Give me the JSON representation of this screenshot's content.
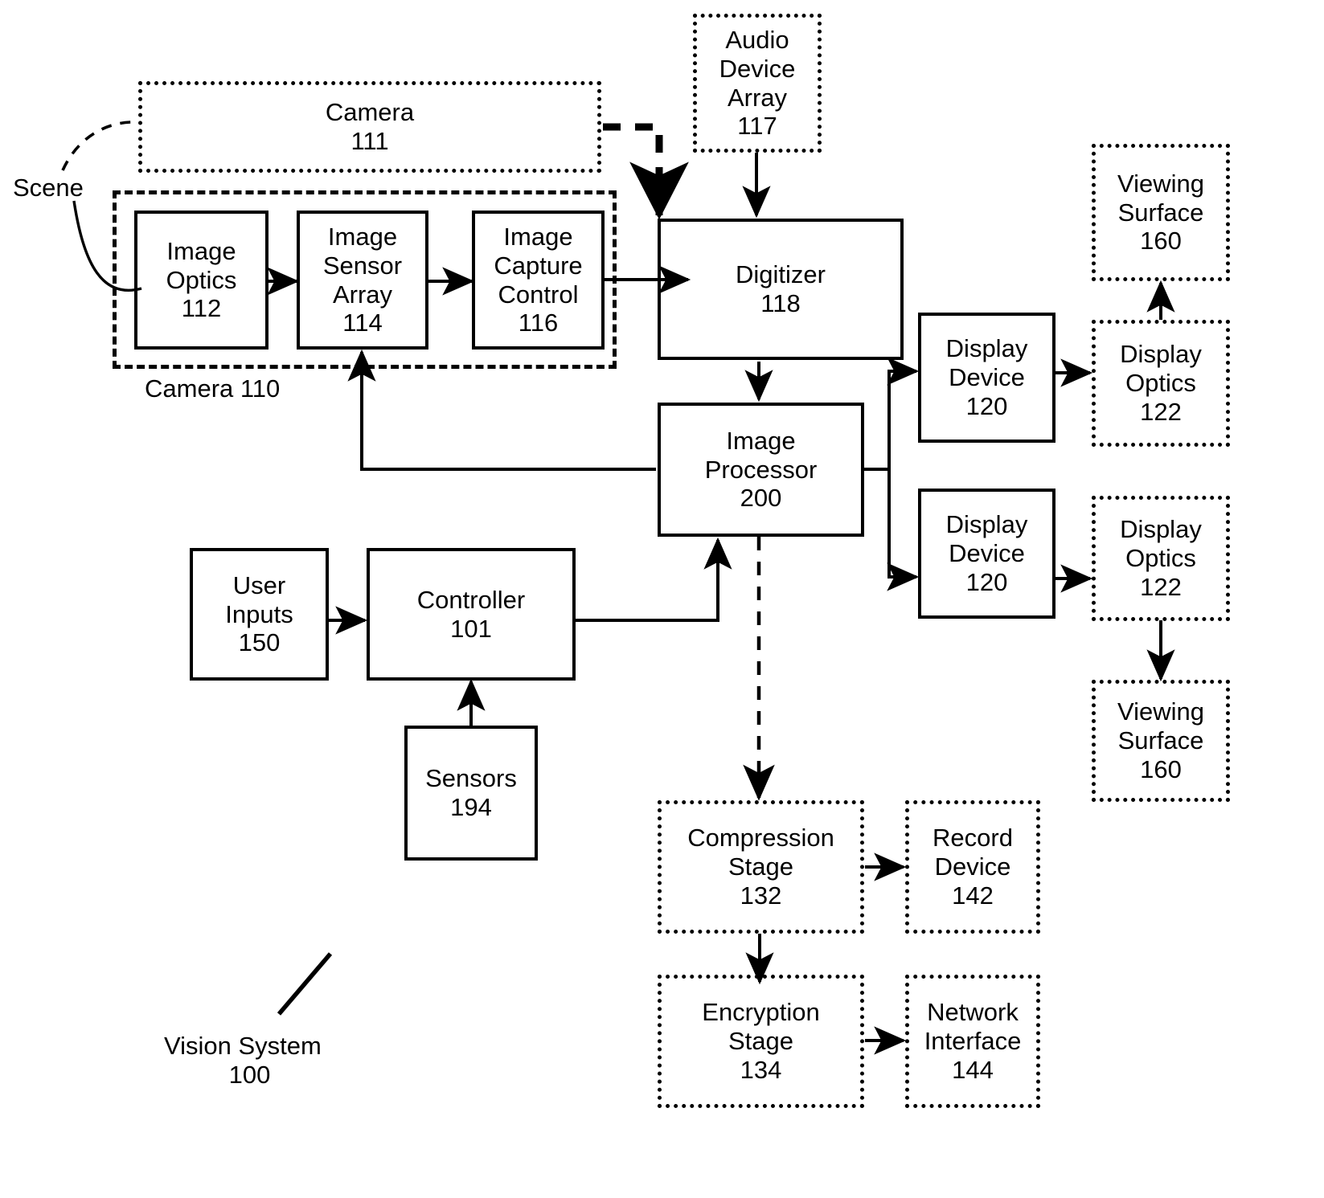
{
  "figure": {
    "title": "Vision System 100 block diagram",
    "line_color": "#000000",
    "background": "#ffffff"
  },
  "labels": {
    "scene": "Scene",
    "camera_group": "Camera 110",
    "vision_system_line1": "Vision System",
    "vision_system_line2": "100"
  },
  "nodes": {
    "camera111": {
      "line1": "Camera",
      "line2": "111",
      "style": "dotted"
    },
    "audio_device_array": {
      "line1": "Audio",
      "line2": "Device",
      "line3": "Array",
      "line4": "117",
      "style": "dotted"
    },
    "image_optics": {
      "line1": "Image",
      "line2": "Optics",
      "line3": "112",
      "style": "solid"
    },
    "image_sensor_array": {
      "line1": "Image",
      "line2": "Sensor",
      "line3": "Array",
      "line4": "114",
      "style": "solid"
    },
    "image_capture_control": {
      "line1": "Image",
      "line2": "Capture",
      "line3": "Control",
      "line4": "116",
      "style": "solid"
    },
    "digitizer": {
      "line1": "Digitizer",
      "line2": "118",
      "style": "solid"
    },
    "image_processor": {
      "line1": "Image",
      "line2": "Processor",
      "line3": "200",
      "style": "solid"
    },
    "user_inputs": {
      "line1": "User",
      "line2": "Inputs",
      "line3": "150",
      "style": "solid"
    },
    "controller": {
      "line1": "Controller",
      "line2": "101",
      "style": "solid"
    },
    "sensors": {
      "line1": "Sensors",
      "line2": "194",
      "style": "solid"
    },
    "display_device_top": {
      "line1": "Display",
      "line2": "Device",
      "line3": "120",
      "style": "solid"
    },
    "display_device_bottom": {
      "line1": "Display",
      "line2": "Device",
      "line3": "120",
      "style": "solid"
    },
    "display_optics_top": {
      "line1": "Display",
      "line2": "Optics",
      "line3": "122",
      "style": "dotted"
    },
    "display_optics_bottom": {
      "line1": "Display",
      "line2": "Optics",
      "line3": "122",
      "style": "dotted"
    },
    "viewing_surface_top": {
      "line1": "Viewing",
      "line2": "Surface",
      "line3": "160",
      "style": "dotted"
    },
    "viewing_surface_bottom": {
      "line1": "Viewing",
      "line2": "Surface",
      "line3": "160",
      "style": "dotted"
    },
    "compression_stage": {
      "line1": "Compression",
      "line2": "Stage",
      "line3": "132",
      "style": "dotted"
    },
    "record_device": {
      "line1": "Record",
      "line2": "Device",
      "line3": "142",
      "style": "dotted"
    },
    "encryption_stage": {
      "line1": "Encryption",
      "line2": "Stage",
      "line3": "134",
      "style": "dotted"
    },
    "network_interface": {
      "line1": "Network",
      "line2": "Interface",
      "line3": "144",
      "style": "dotted"
    }
  },
  "connections": [
    {
      "from": "scene",
      "to": "image_optics",
      "style": "curve-solid"
    },
    {
      "from": "scene",
      "to": "camera111",
      "style": "curve-dashed"
    },
    {
      "from": "image_optics",
      "to": "image_sensor_array",
      "style": "arrow-solid"
    },
    {
      "from": "image_sensor_array",
      "to": "image_capture_control",
      "style": "arrow-solid"
    },
    {
      "from": "image_capture_control",
      "to": "digitizer",
      "style": "arrow-solid"
    },
    {
      "from": "camera111",
      "to": "digitizer",
      "style": "arrow-dashed-thick"
    },
    {
      "from": "audio_device_array",
      "to": "digitizer",
      "style": "arrow-solid"
    },
    {
      "from": "digitizer",
      "to": "image_processor",
      "style": "arrow-solid"
    },
    {
      "from": "image_processor",
      "to": "image_sensor_array",
      "style": "arrow-solid-feedback"
    },
    {
      "from": "image_processor",
      "to": "display_device_top",
      "style": "arrow-solid"
    },
    {
      "from": "image_processor",
      "to": "display_device_bottom",
      "style": "arrow-solid"
    },
    {
      "from": "display_device_top",
      "to": "display_optics_top",
      "style": "arrow-solid"
    },
    {
      "from": "display_optics_top",
      "to": "viewing_surface_top",
      "style": "arrow-solid"
    },
    {
      "from": "display_device_bottom",
      "to": "display_optics_bottom",
      "style": "arrow-solid"
    },
    {
      "from": "display_optics_bottom",
      "to": "viewing_surface_bottom",
      "style": "arrow-solid"
    },
    {
      "from": "image_processor",
      "to": "compression_stage",
      "style": "arrow-dashed"
    },
    {
      "from": "compression_stage",
      "to": "record_device",
      "style": "arrow-solid"
    },
    {
      "from": "compression_stage",
      "to": "encryption_stage",
      "style": "arrow-solid"
    },
    {
      "from": "encryption_stage",
      "to": "network_interface",
      "style": "arrow-solid"
    },
    {
      "from": "user_inputs",
      "to": "controller",
      "style": "arrow-solid"
    },
    {
      "from": "sensors",
      "to": "controller",
      "style": "arrow-solid"
    },
    {
      "from": "controller",
      "to": "image_processor",
      "style": "arrow-solid"
    }
  ]
}
